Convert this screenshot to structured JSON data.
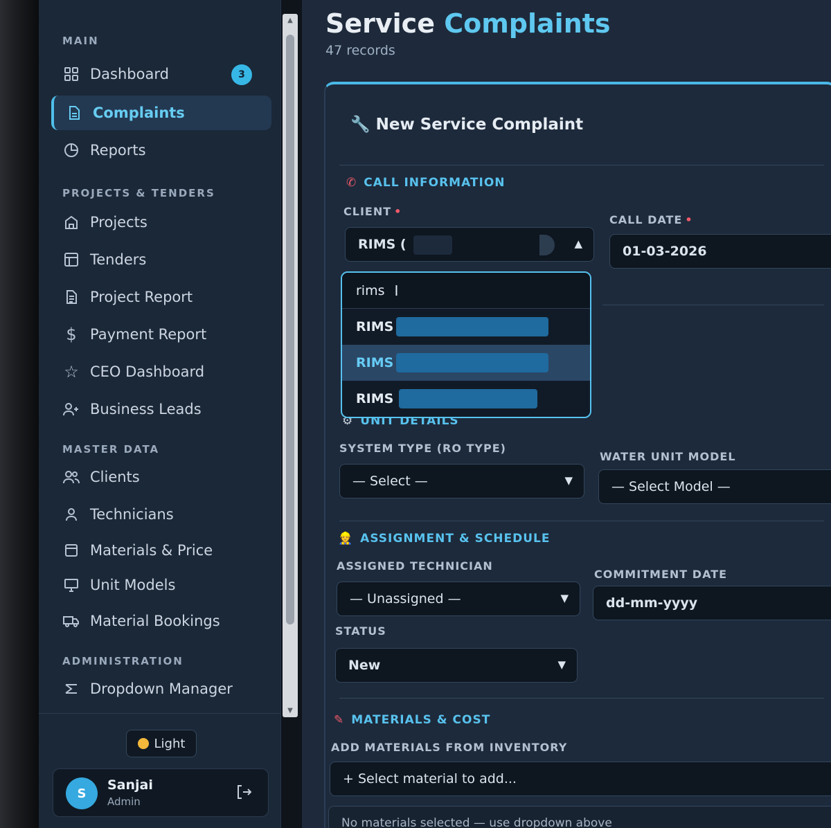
{
  "sidebar": {
    "sections": {
      "main": "MAIN",
      "projects": "PROJECTS & TENDERS",
      "master": "MASTER DATA",
      "admin": "ADMINISTRATION"
    },
    "items": {
      "dashboard": {
        "label": "Dashboard",
        "badge": "3",
        "icon": "grid-icon"
      },
      "complaints": {
        "label": "Complaints",
        "icon": "document-icon",
        "active": true
      },
      "reports": {
        "label": "Reports",
        "icon": "pie-chart-icon"
      },
      "projects": {
        "label": "Projects",
        "icon": "building-icon"
      },
      "tenders": {
        "label": "Tenders",
        "icon": "layout-icon"
      },
      "project_report": {
        "label": "Project Report",
        "icon": "file-icon"
      },
      "payment_report": {
        "label": "Payment Report",
        "icon": "dollar-icon"
      },
      "ceo_dashboard": {
        "label": "CEO Dashboard",
        "icon": "star-icon"
      },
      "business_leads": {
        "label": "Business Leads",
        "icon": "users-plus-icon"
      },
      "clients": {
        "label": "Clients",
        "icon": "users-icon"
      },
      "technicians": {
        "label": "Technicians",
        "icon": "user-icon"
      },
      "materials": {
        "label": "Materials & Price",
        "icon": "box-icon"
      },
      "unit_models": {
        "label": "Unit Models",
        "icon": "monitor-icon"
      },
      "material_bookings": {
        "label": "Material Bookings",
        "icon": "truck-icon"
      },
      "dropdown_manager": {
        "label": "Dropdown Manager",
        "icon": "sliders-icon"
      }
    },
    "theme_toggle": "Light",
    "user": {
      "initial": "S",
      "name": "Sanjai",
      "role": "Admin"
    }
  },
  "header": {
    "title_part1": "Service",
    "title_part2": "Complaints",
    "record_count": "47 records"
  },
  "form": {
    "title": "New Service Complaint",
    "call_info": {
      "section": "CALL INFORMATION",
      "client_label": "CLIENT",
      "client_value": "RIMS (",
      "call_date_label": "CALL DATE",
      "call_date_value": "01-03-2026"
    },
    "client_dropdown": {
      "search_value": "rims",
      "options": [
        "RIMS (",
        "RIMS (",
        "RIMS (("
      ]
    },
    "unit": {
      "section": "UNIT DETAILS",
      "system_type_label": "SYSTEM TYPE (RO TYPE)",
      "system_type_value": "— Select —",
      "model_label": "WATER UNIT MODEL",
      "model_value": "— Select Model —"
    },
    "assignment": {
      "section": "ASSIGNMENT & SCHEDULE",
      "technician_label": "ASSIGNED TECHNICIAN",
      "technician_value": "— Unassigned —",
      "commitment_label": "COMMITMENT DATE",
      "commitment_placeholder": "dd-mm-yyyy",
      "status_label": "STATUS",
      "status_value": "New"
    },
    "materials": {
      "section": "MATERIALS & COST",
      "add_label": "ADD MATERIALS FROM INVENTORY",
      "add_placeholder": "+ Select material to add...",
      "empty_text": "No materials selected — use dropdown above"
    }
  },
  "colors": {
    "accent": "#5fc8f0",
    "required": "#ef5a6a",
    "sidebar_bg": "#1b2838",
    "main_bg": "#1e2a3b"
  }
}
